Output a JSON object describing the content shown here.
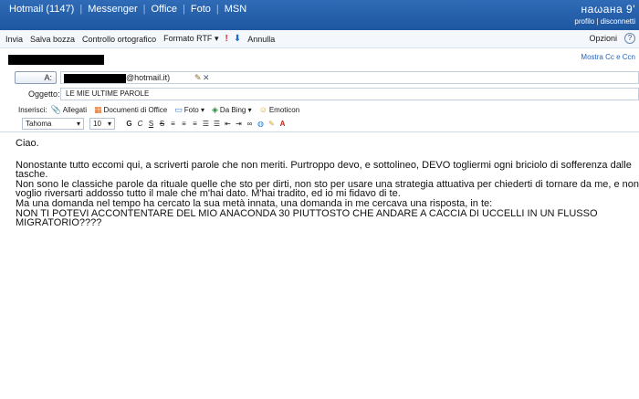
{
  "topnav": {
    "items": [
      "Hotmail (1147)",
      "Messenger",
      "Office",
      "Foto",
      "MSN"
    ],
    "user_name": "наωана 9'",
    "profile_link": "profilo",
    "logout_link": "disconnetti"
  },
  "toolbar": {
    "send": "Invia",
    "save_draft": "Salva bozza",
    "spellcheck": "Controllo ortografico",
    "format": "Formato RTF",
    "cancel": "Annulla",
    "options": "Opzioni"
  },
  "compose": {
    "show_cc": "Mostra Cc e Ccn",
    "to_button": "A:",
    "to_address_visible": "@hotmail.it)",
    "subject_label": "Oggetto:",
    "subject": "LE MIE ULTIME PAROLE",
    "insert_label": "Inserisci:",
    "insert_items": [
      {
        "label": "Allegati",
        "icon": "paperclip-icon"
      },
      {
        "label": "Documenti di Office",
        "icon": "office-icon"
      },
      {
        "label": "Foto",
        "icon": "photo-icon"
      },
      {
        "label": "Da Bing",
        "icon": "bing-icon"
      },
      {
        "label": "Emoticon",
        "icon": "emoticon-icon"
      }
    ],
    "font": "Tahoma",
    "font_size": "10"
  },
  "message": {
    "greeting": "Ciao.",
    "lines": [
      "Nonostante tutto eccomi qui, a scriverti parole che non meriti. Purtroppo devo, e sottolineo, DEVO togliermi ogni briciolo di sofferenza dalle tasche.",
      "Non sono le classiche parole da rituale quelle che sto per dirti, non sto per usare una strategia attuativa per chiederti di tornare da me, e non voglio riversarti addosso tutto il male che m'hai dato. M'hai tradito, ed io mi fidavo di te.",
      "Ma una domanda nel tempo ha cercato la sua metà innata, una domanda in me cercava una risposta, in te:",
      "NON TI POTEVI ACCONTENTARE DEL MIO ANACONDA 30 PIUTTOSTO CHE ANDARE A CACCIA DI UCCELLI IN UN FLUSSO MIGRATORIO????"
    ]
  },
  "colors": {
    "nav_bg": "#1e56a0",
    "link": "#2a63b6",
    "alert": "#d32f2f"
  }
}
